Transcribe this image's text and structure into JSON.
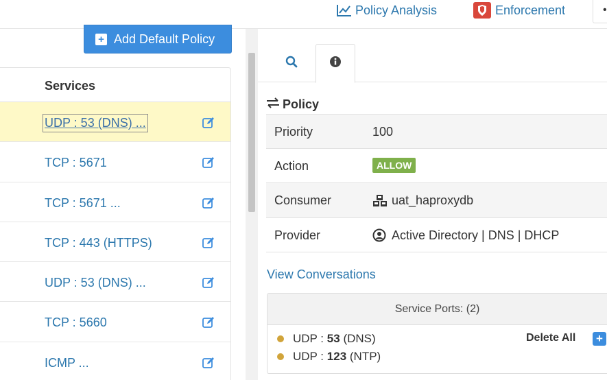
{
  "colors": {
    "link": "#2b77ad",
    "primary": "#3c8dde",
    "allow": "#7fb04b",
    "selected_row": "#fef9c7",
    "enforcement_icon": "#d9473b",
    "port_dot": "#d1a43a"
  },
  "topnav": {
    "policy_analysis": {
      "label": "Policy Analysis",
      "icon": "line-chart-icon"
    },
    "enforcement": {
      "label": "Enforcement",
      "icon": "shield-icon"
    },
    "more": "•"
  },
  "add_default_policy": {
    "label": "Add Default Policy",
    "icon": "plus-square-icon"
  },
  "services": {
    "header": "Services",
    "rows": [
      {
        "label": "UDP : 53 (DNS) ...",
        "selected": true
      },
      {
        "label": "TCP : 5671",
        "selected": false
      },
      {
        "label": "TCP : 5671 ...",
        "selected": false
      },
      {
        "label": "TCP : 443 (HTTPS)",
        "selected": false
      },
      {
        "label": "UDP : 53 (DNS) ...",
        "selected": false
      },
      {
        "label": "TCP : 5660",
        "selected": false
      },
      {
        "label": "ICMP ...",
        "selected": false
      }
    ],
    "edit_icon": "edit-icon"
  },
  "tabs": [
    {
      "name": "search",
      "icon": "search-icon",
      "active": false
    },
    {
      "name": "info",
      "icon": "info-icon",
      "active": true
    }
  ],
  "policy": {
    "heading": "Policy",
    "heading_icon": "exchange-arrows-icon",
    "rows": [
      {
        "key": "Priority",
        "value": "100"
      },
      {
        "key": "Action",
        "value": "ALLOW"
      },
      {
        "key": "Consumer",
        "value": "uat_haproxydb",
        "icon": "cubes-icon"
      },
      {
        "key": "Provider",
        "value": "Active Directory | DNS | DHCP",
        "icon": "user-circle-icon"
      }
    ]
  },
  "view_conversations": "View Conversations",
  "service_ports": {
    "header": "Service Ports: (2)",
    "items": [
      {
        "proto": "UDP :",
        "port": "53",
        "name": "(DNS)"
      },
      {
        "proto": "UDP :",
        "port": "123",
        "name": "(NTP)"
      }
    ],
    "delete_all": "Delete All",
    "add": "+"
  }
}
